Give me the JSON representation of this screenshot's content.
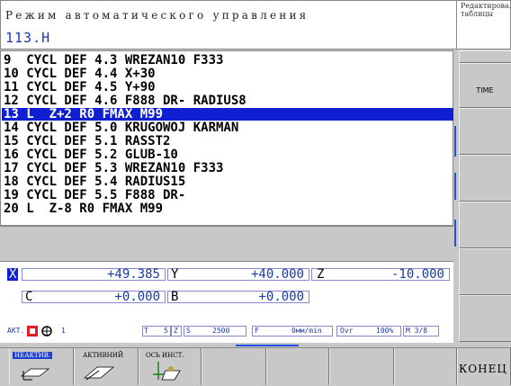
{
  "header": {
    "mode": "Режим автоматического управления",
    "file": "113.H",
    "right_label": "Редактирова.\nтаблицы"
  },
  "program": {
    "lines": [
      "9  CYCL DEF 4.3 WREZAN10 F333",
      "10 CYCL DEF 4.4 X+30",
      "11 CYCL DEF 4.5 Y+90",
      "12 CYCL DEF 4.6 F888 DR- RADIUS8",
      "13 L  Z+2 R0 FMAX M99",
      "14 CYCL DEF 5.0 KRUGOWOJ KARMAN",
      "15 CYCL DEF 5.1 RASST2",
      "16 CYCL DEF 5.2 GLUB-10",
      "17 CYCL DEF 5.3 WREZAN10 F333",
      "18 CYCL DEF 5.4 RADIUS15",
      "19 CYCL DEF 5.5 F888 DR-",
      "20 L  Z-8 R0 FMAX M99"
    ],
    "selected_index": 4
  },
  "positions": {
    "x_label": "X",
    "x_value": "+49.385",
    "y_label": "Y",
    "y_value": "+40.000",
    "z_label": "Z",
    "z_value": "-10.000",
    "c_label": "C",
    "c_value": "+0.000",
    "b_label": "B",
    "b_value": "+0.000"
  },
  "status": {
    "act": "АКТ.",
    "tool_no": "1",
    "t": "T",
    "s_label": "5",
    "z": "Z",
    "s": "S",
    "speed": "2500",
    "f": "F",
    "feed": "0мм/min",
    "ovr_label": "Ovr",
    "ovr": "100%",
    "m": "M 3/8"
  },
  "softkeys_right": {
    "time": "TIME"
  },
  "softkeys_bottom": {
    "inactive": "НЕАКТИВ.",
    "active": "АКТИВНИЙ",
    "tool_axis": "ОСЬ ИНСТ.",
    "end": "КОНЕЦ"
  },
  "colors": {
    "selection": "#1020d0",
    "value_text": "#1a3aa6",
    "panel": "#c8c8c8"
  }
}
